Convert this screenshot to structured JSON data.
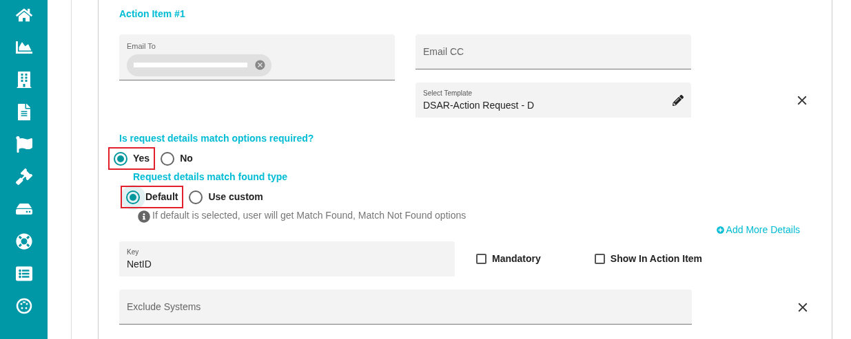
{
  "action_item": {
    "title": "Action Item #1",
    "email_to": {
      "label": "Email To"
    },
    "email_cc": {
      "placeholder": "Email CC"
    },
    "template": {
      "label": "Select Template",
      "value": "DSAR-Action Request - D"
    },
    "match_required": {
      "label": "Is request details match options required?",
      "options": [
        {
          "label": "Yes",
          "selected": true,
          "highlighted": true
        },
        {
          "label": "No",
          "selected": false,
          "highlighted": false
        }
      ]
    },
    "match_type": {
      "label": "Request details match found type",
      "options": [
        {
          "label": "Default",
          "selected": true,
          "highlighted": true
        },
        {
          "label": "Use custom",
          "selected": false,
          "highlighted": false
        }
      ],
      "hint": "If default is selected, user will get Match Found, Match Not Found options"
    },
    "add_more": "Add More Details",
    "key": {
      "label": "Key",
      "value": "NetID"
    },
    "checkboxes": [
      {
        "label": "Mandatory",
        "checked": false
      },
      {
        "label": "Show In Action Item",
        "checked": false
      }
    ],
    "exclude_systems": {
      "placeholder": "Exclude Systems"
    }
  }
}
